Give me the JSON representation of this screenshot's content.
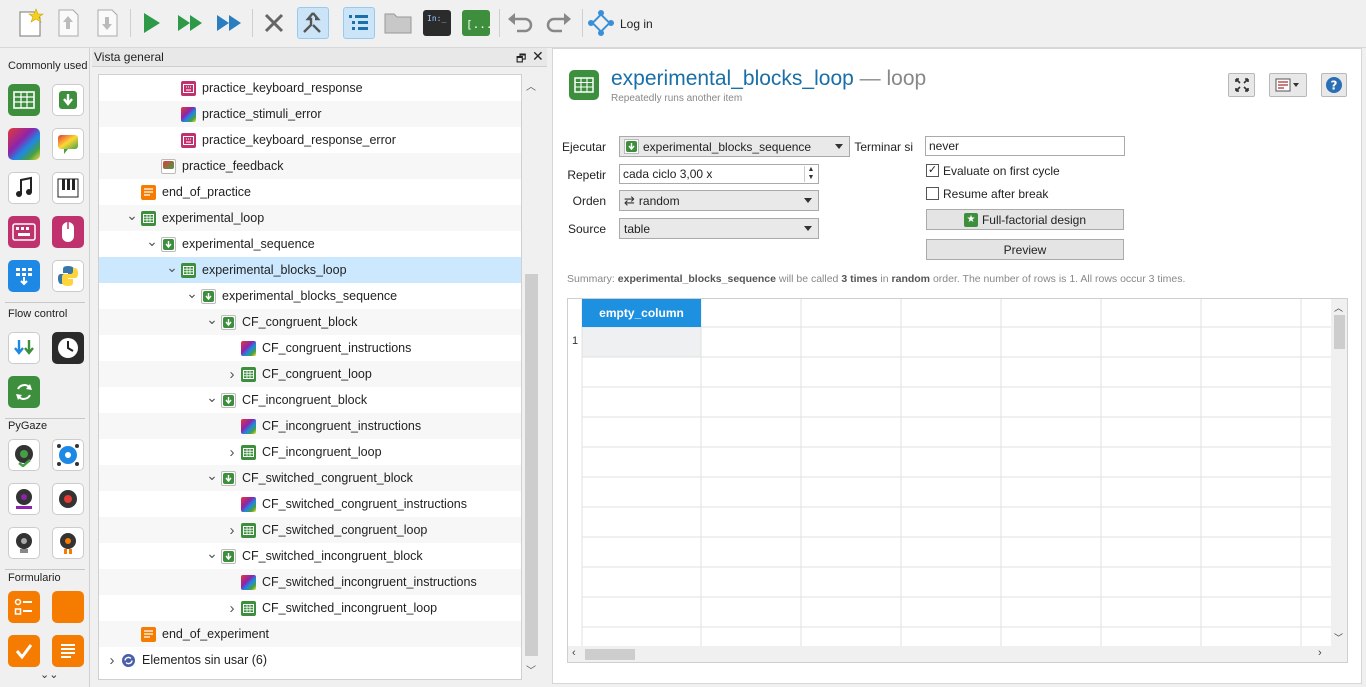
{
  "toolbar": {
    "buttons": [
      {
        "name": "new-experiment-button",
        "icon": "new-file-icon"
      },
      {
        "name": "open-up-button",
        "icon": "arrow-up-icon"
      },
      {
        "name": "save-down-button",
        "icon": "arrow-down-icon"
      },
      {
        "name": "run-button",
        "icon": "play-icon"
      },
      {
        "name": "run-window-button",
        "icon": "fast-forward-icon"
      },
      {
        "name": "quick-run-button",
        "icon": "skip-forward-icon"
      },
      {
        "name": "kill-button",
        "icon": "close-icon"
      },
      {
        "name": "close-tabs-button",
        "icon": "merge-icon"
      },
      {
        "name": "overview-toggle-button",
        "icon": "list-icon"
      },
      {
        "name": "file-pool-button",
        "icon": "folder-icon"
      },
      {
        "name": "debug-window-button",
        "icon": "terminal-icon"
      },
      {
        "name": "variable-inspector-button",
        "icon": "brackets-icon"
      },
      {
        "name": "undo-button",
        "icon": "undo-icon"
      },
      {
        "name": "redo-button",
        "icon": "redo-icon"
      }
    ],
    "login_label": "Log in"
  },
  "leftbar": {
    "categories": [
      {
        "label": "Commonly used"
      },
      {
        "label": "Flow control"
      },
      {
        "label": "PyGaze"
      },
      {
        "label": "Formulario"
      }
    ]
  },
  "overview": {
    "title": "Vista general",
    "float_symbol": "🗗",
    "close_symbol": "✕",
    "rows": [
      {
        "label": "practice_keyboard_response",
        "icon": "keyboard-icon",
        "type": "keyboard",
        "depth": 3,
        "arrow": ""
      },
      {
        "label": "practice_stimuli_error",
        "icon": "sketchpad-icon",
        "type": "sketchpad",
        "depth": 3,
        "arrow": ""
      },
      {
        "label": "practice_keyboard_response_error",
        "icon": "keyboard-icon",
        "type": "keyboard",
        "depth": 3,
        "arrow": ""
      },
      {
        "label": "practice_feedback",
        "icon": "feedback-icon",
        "type": "feedback",
        "depth": 2,
        "arrow": ""
      },
      {
        "label": "end_of_practice",
        "icon": "form-text-icon",
        "type": "form",
        "depth": 1,
        "arrow": ""
      },
      {
        "label": "experimental_loop",
        "icon": "loop-icon",
        "type": "loop",
        "depth": 1,
        "arrow": "open"
      },
      {
        "label": "experimental_sequence",
        "icon": "sequence-icon",
        "type": "sequence",
        "depth": 2,
        "arrow": "open"
      },
      {
        "label": "experimental_blocks_loop",
        "icon": "loop-icon",
        "type": "loop",
        "depth": 3,
        "arrow": "open"
      },
      {
        "label": "experimental_blocks_sequence",
        "icon": "sequence-icon",
        "type": "sequence",
        "depth": 4,
        "arrow": "open"
      },
      {
        "label": "CF_congruent_block",
        "icon": "sequence-icon",
        "type": "sequence",
        "depth": 5,
        "arrow": "open"
      },
      {
        "label": "CF_congruent_instructions",
        "icon": "sketchpad-icon",
        "type": "sketchpad",
        "depth": 6,
        "arrow": ""
      },
      {
        "label": "CF_congruent_loop",
        "icon": "loop-icon",
        "type": "loop",
        "depth": 6,
        "arrow": "closed"
      },
      {
        "label": "CF_incongruent_block",
        "icon": "sequence-icon",
        "type": "sequence",
        "depth": 5,
        "arrow": "open"
      },
      {
        "label": "CF_incongruent_instructions",
        "icon": "sketchpad-icon",
        "type": "sketchpad",
        "depth": 6,
        "arrow": ""
      },
      {
        "label": "CF_incongruent_loop",
        "icon": "loop-icon",
        "type": "loop",
        "depth": 6,
        "arrow": "closed"
      },
      {
        "label": "CF_switched_congruent_block",
        "icon": "sequence-icon",
        "type": "sequence",
        "depth": 5,
        "arrow": "open"
      },
      {
        "label": "CF_switched_congruent_instructions",
        "icon": "sketchpad-icon",
        "type": "sketchpad",
        "depth": 6,
        "arrow": ""
      },
      {
        "label": "CF_switched_congruent_loop",
        "icon": "loop-icon",
        "type": "loop",
        "depth": 6,
        "arrow": "closed"
      },
      {
        "label": "CF_switched_incongruent_block",
        "icon": "sequence-icon",
        "type": "sequence",
        "depth": 5,
        "arrow": "open"
      },
      {
        "label": "CF_switched_incongruent_instructions",
        "icon": "sketchpad-icon",
        "type": "sketchpad",
        "depth": 6,
        "arrow": ""
      },
      {
        "label": "CF_switched_incongruent_loop",
        "icon": "loop-icon",
        "type": "loop",
        "depth": 6,
        "arrow": "closed"
      },
      {
        "label": "end_of_experiment",
        "icon": "form-text-icon",
        "type": "form",
        "depth": 1,
        "arrow": ""
      },
      {
        "label": "Elementos sin usar (6)",
        "icon": "recycle-icon",
        "type": "unused",
        "depth": 0,
        "arrow": "closed"
      }
    ],
    "selected_index": 7
  },
  "editor": {
    "item_name": "experimental_blocks_loop",
    "item_type": " — loop",
    "description": "Repeatedly runs another item",
    "fields": {
      "run_label": "Ejecutar",
      "run_value": "experimental_blocks_sequence",
      "repeat_label": "Repetir",
      "repeat_value": "cada ciclo 3,00 x",
      "order_label": "Orden",
      "order_value": "random",
      "source_label": "Source",
      "source_value": "table",
      "break_label": "Terminar si",
      "break_value": "never",
      "eval_first_label": "Evaluate on first cycle",
      "eval_first_checked": true,
      "resume_label": "Resume after break",
      "resume_checked": false,
      "full_factorial_label": "Full-factorial design",
      "preview_label": "Preview"
    },
    "summary": {
      "prefix": "Summary: ",
      "item": "experimental_blocks_sequence",
      "mid1": " will be called ",
      "times": "3 times",
      "mid2": " in ",
      "order": "random",
      "suffix": " order. The number of rows is 1. All rows occur 3 times."
    },
    "table": {
      "columns": [
        "empty_column"
      ],
      "rows": [
        {
          "num": "1",
          "cells": [
            ""
          ]
        }
      ]
    }
  }
}
